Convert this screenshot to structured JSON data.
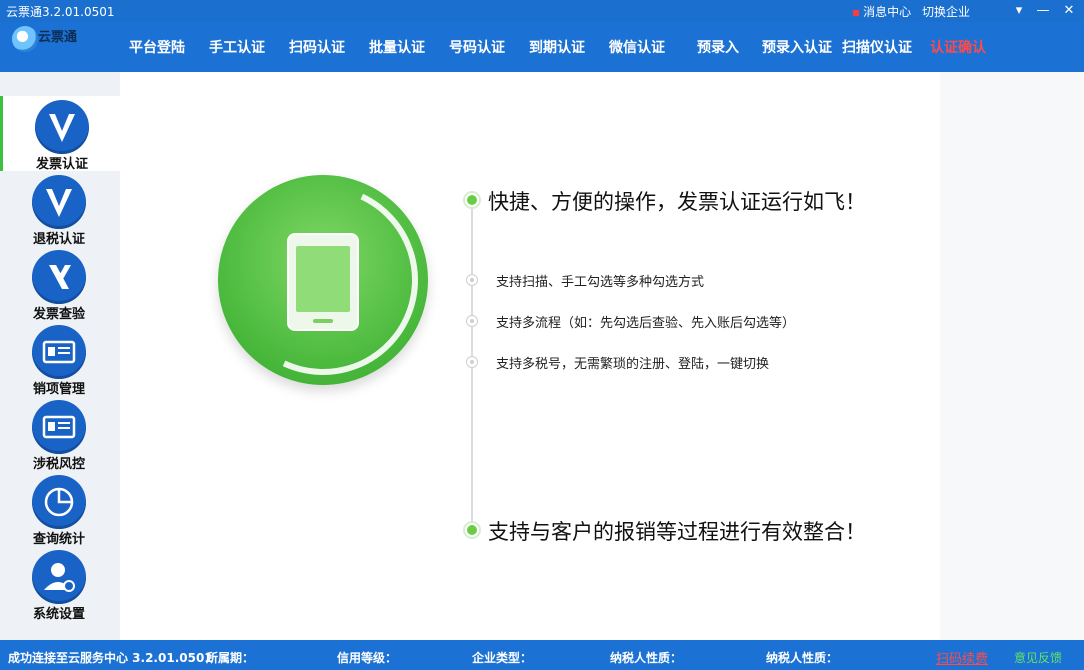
{
  "window": {
    "title": "云票通3.2.01.0501",
    "message_center": "消息中心",
    "switch_company": "切换企业"
  },
  "logo": {
    "text": "云票通"
  },
  "nav": [
    {
      "label": "平台登陆"
    },
    {
      "label": "手工认证"
    },
    {
      "label": "扫码认证"
    },
    {
      "label": "批量认证"
    },
    {
      "label": "号码认证"
    },
    {
      "label": "到期认证"
    },
    {
      "label": "微信认证"
    },
    {
      "label": "预录入"
    },
    {
      "label": "预录入认证"
    },
    {
      "label": "扫描仪认证"
    },
    {
      "label": "认证确认"
    }
  ],
  "sidebar": [
    {
      "label": "发票认证"
    },
    {
      "label": "退税认证"
    },
    {
      "label": "发票查验"
    },
    {
      "label": "销项管理"
    },
    {
      "label": "涉税风控"
    },
    {
      "label": "查询统计"
    },
    {
      "label": "系统设置"
    }
  ],
  "main": {
    "headline1": "快捷、方便的操作，发票认证运行如飞！",
    "features": [
      "支持扫描、手工勾选等多种勾选方式",
      "支持多流程（如：先勾选后查验、先入账后勾选等）",
      "支持多税号，无需繁琐的注册、登陆，一键切换"
    ],
    "headline2": "支持与客户的报销等过程进行有效整合！"
  },
  "status": {
    "connection": "成功连接至云服务中心 3.2.01.0501",
    "period": "所属期：",
    "credit": "信用等级：",
    "company_type": "企业类型：",
    "taxpayer1": "纳税人性质：",
    "taxpayer2": "纳税人性质：",
    "renew": "扫码续费",
    "feedback": "意见反馈"
  },
  "colors": {
    "primary": "#1c72d4",
    "accent_green": "#47b73a",
    "active_red": "#ff4a4a"
  }
}
